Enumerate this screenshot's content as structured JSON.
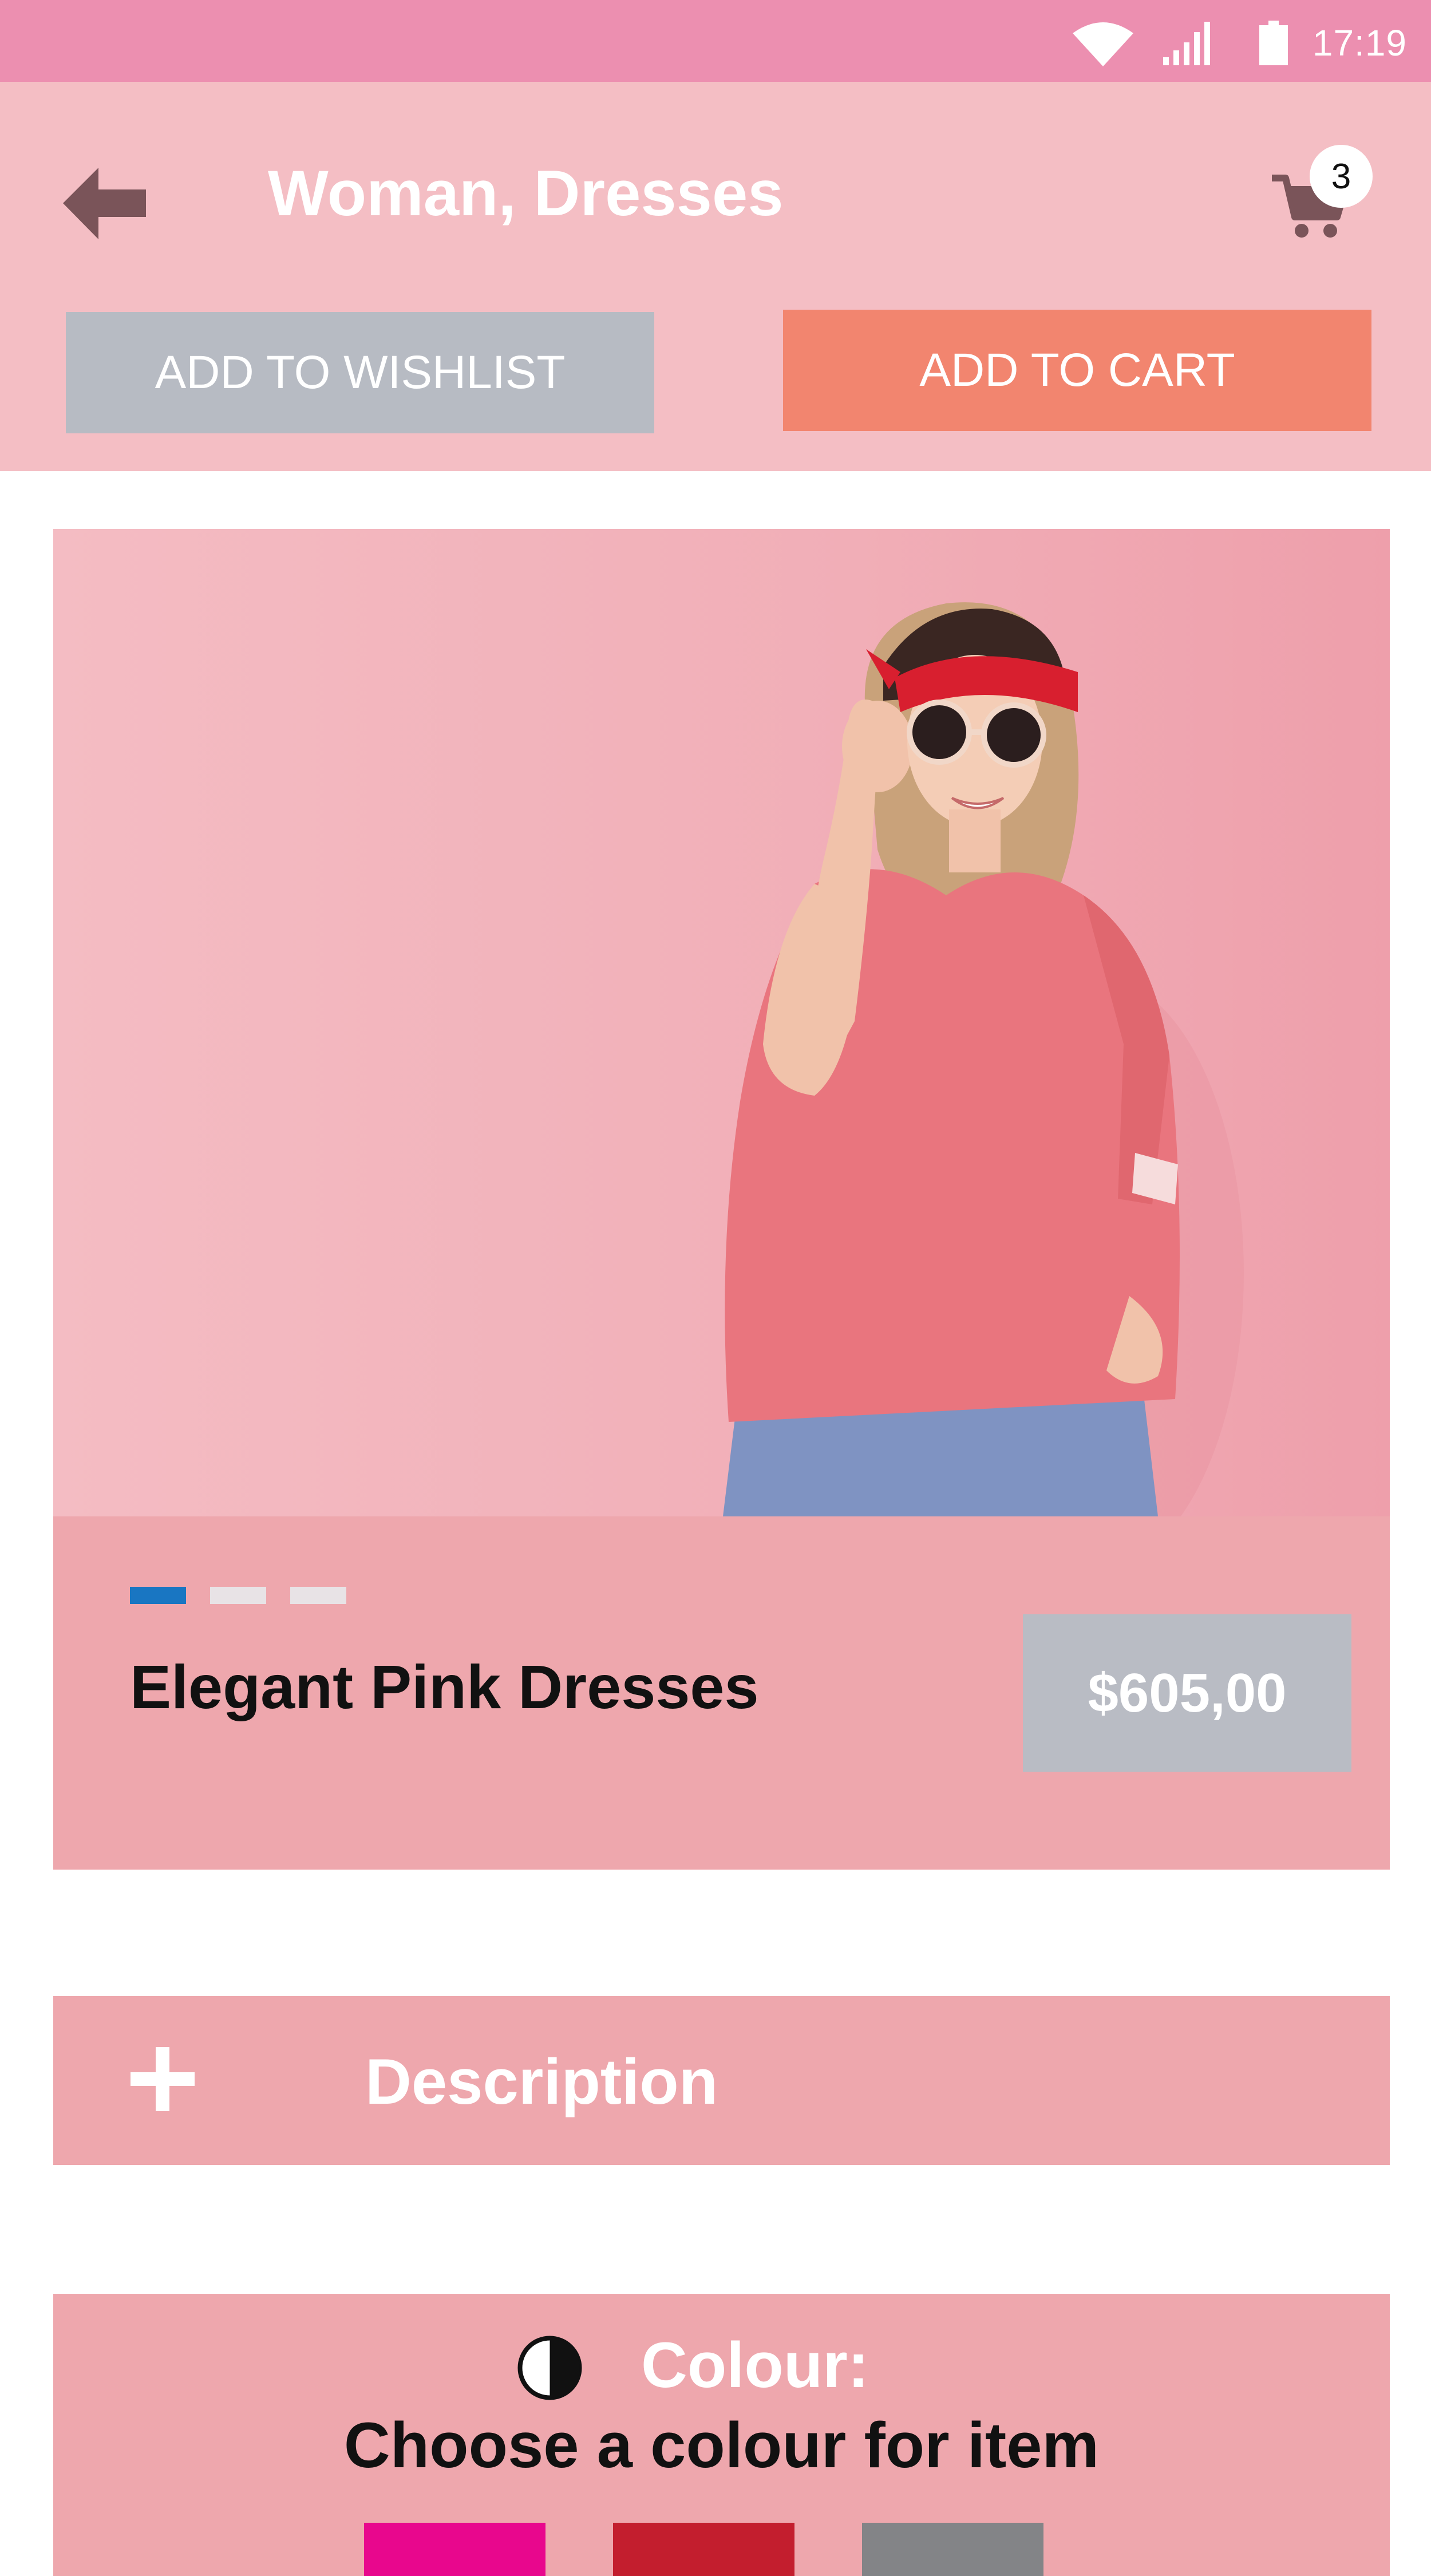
{
  "status_bar": {
    "time": "17:19",
    "wifi_icon": "wifi-icon",
    "signal_icon": "signal-icon",
    "battery_icon": "battery-icon"
  },
  "header": {
    "back_icon": "back-arrow-icon",
    "title": "Woman, Dresses",
    "cart_icon": "cart-icon",
    "cart_count": "3"
  },
  "actions": {
    "wishlist_label": "ADD TO WISHLIST",
    "cart_label": "ADD TO CART"
  },
  "product": {
    "image_subject": "woman-in-pink-tshirt-photo",
    "carousel": {
      "count": 3,
      "active_index": 0
    },
    "name": "Elegant Pink Dresses",
    "price": "$605,00"
  },
  "description": {
    "icon": "plus-icon",
    "label": "Description"
  },
  "colour": {
    "icon": "contrast-icon",
    "title": "Colour:",
    "subtitle": "Choose a colour for item",
    "swatches": [
      "#e8078d",
      "#c31e2e",
      "#838487"
    ]
  },
  "colors": {
    "status_bar": "#ec8fb0",
    "header_bg": "#f4bec4",
    "card_bg": "#eea7ad",
    "wishlist_btn": "#b7bbc3",
    "cart_btn": "#f2856f",
    "price_bg": "#b9bcc4",
    "dot_active": "#1976c2"
  }
}
